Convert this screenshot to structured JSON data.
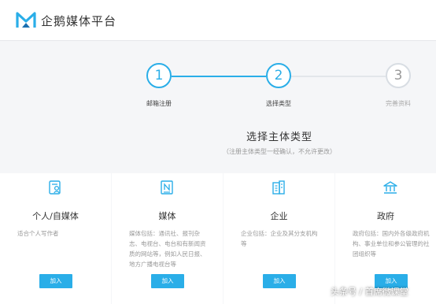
{
  "brand": {
    "name": "企鹅媒体平台",
    "accent_color": "#2aaee8"
  },
  "steps": [
    {
      "number": "1",
      "label": "邮箱注册",
      "state": "done"
    },
    {
      "number": "2",
      "label": "选择类型",
      "state": "current"
    },
    {
      "number": "3",
      "label": "完善资料",
      "state": "todo"
    }
  ],
  "section": {
    "title": "选择主体类型",
    "subtitle": "（注册主体类型一经确认，不允许更改）"
  },
  "cards": [
    {
      "icon": "id-card-icon",
      "title": "个人/自媒体",
      "desc": "适合个人写作者",
      "button": "加入"
    },
    {
      "icon": "newspaper-icon",
      "title": "媒体",
      "desc": "媒体包括：通讯社、报刊杂志、电视台、电台和有新闻资质的网站等，例如人民日报、地方广播电视台等",
      "button": "加入"
    },
    {
      "icon": "building-icon",
      "title": "企业",
      "desc": "企业包括：企业及其分支机构等",
      "button": "加入"
    },
    {
      "icon": "government-icon",
      "title": "政府",
      "desc": "政府包括：国内外各级政府机构、事业单位和参公管理的社团组织等",
      "button": "加入"
    }
  ],
  "watermark": "头条号 / 首席微课堂"
}
